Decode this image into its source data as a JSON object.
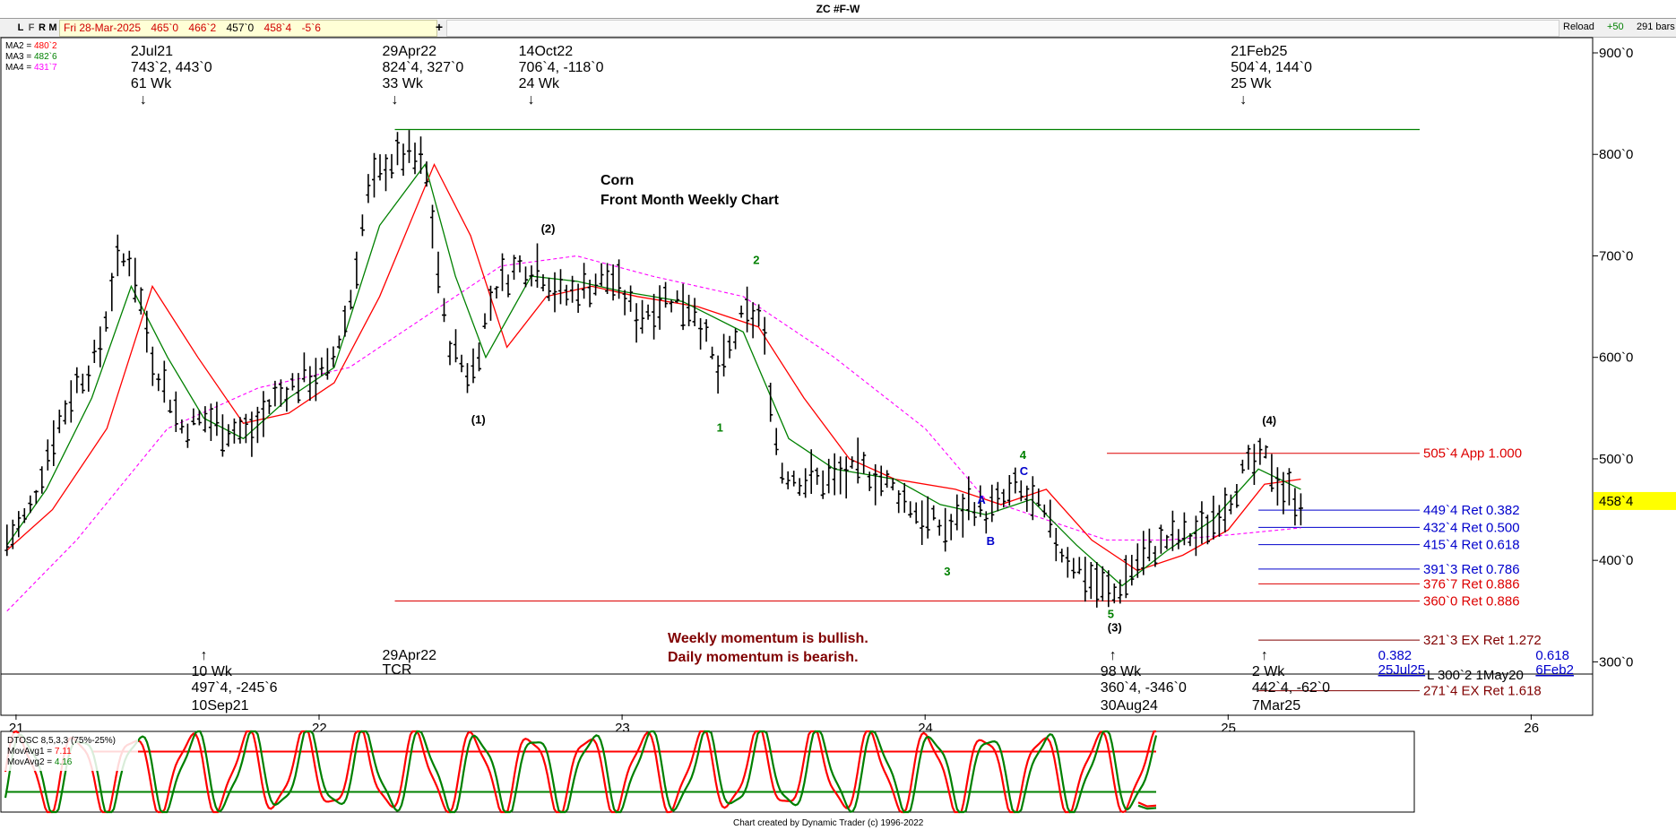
{
  "window": {
    "title": "ZC #F-W"
  },
  "toolbar": {
    "buttons": [
      "L",
      "F",
      "R",
      "M"
    ],
    "quote": [
      "Fri 28-Mar-2025",
      "465`0",
      "466`2",
      "457`0",
      "458`4",
      "-5`6"
    ],
    "reload_label": "Reload",
    "reload_value": "+50",
    "bars_label": "291 bars"
  },
  "colors": {
    "price_bars": "#000000",
    "ma2": "#ff0000",
    "ma3": "#008000",
    "ma4": "#ff00ff",
    "blue": "#0000cc",
    "red": "#dd0000",
    "dark_red": "#800000",
    "green": "#008000"
  },
  "legend": [
    {
      "label": "MA2 =",
      "value": "480`2",
      "color": "#ff0000"
    },
    {
      "label": "MA3 =",
      "value": "482`6",
      "color": "#008000"
    },
    {
      "label": "MA4 =",
      "value": "431`7",
      "color": "#ff00ff"
    }
  ],
  "chart_data": {
    "type": "line",
    "title": "Corn",
    "subtitle": "Front Month Weekly Chart",
    "x_ticks": [
      "21",
      "22",
      "23",
      "24",
      "25",
      "26"
    ],
    "y_ticks": [
      "900`0",
      "800`0",
      "700`0",
      "600`0",
      "500`0",
      "400`0",
      "300`0"
    ],
    "y_values": [
      900,
      800,
      700,
      600,
      500,
      400,
      300
    ],
    "ylim": [
      288,
      915
    ],
    "xlim": [
      2020.95,
      2026.2
    ],
    "last_price": "458`4",
    "last_price_value": 458.5,
    "price_path": [
      [
        2020.97,
        420
      ],
      [
        2021.04,
        445
      ],
      [
        2021.12,
        520
      ],
      [
        2021.2,
        575
      ],
      [
        2021.27,
        600
      ],
      [
        2021.33,
        690
      ],
      [
        2021.38,
        700
      ],
      [
        2021.45,
        600
      ],
      [
        2021.55,
        530
      ],
      [
        2021.62,
        540
      ],
      [
        2021.7,
        530
      ],
      [
        2021.78,
        525
      ],
      [
        2021.85,
        560
      ],
      [
        2021.95,
        580
      ],
      [
        2022.03,
        585
      ],
      [
        2022.1,
        650
      ],
      [
        2022.16,
        760
      ],
      [
        2022.22,
        790
      ],
      [
        2022.28,
        800
      ],
      [
        2022.35,
        790
      ],
      [
        2022.42,
        620
      ],
      [
        2022.5,
        580
      ],
      [
        2022.58,
        670
      ],
      [
        2022.66,
        690
      ],
      [
        2022.72,
        690
      ],
      [
        2022.8,
        660
      ],
      [
        2022.88,
        670
      ],
      [
        2022.96,
        680
      ],
      [
        2023.05,
        640
      ],
      [
        2023.15,
        660
      ],
      [
        2023.24,
        650
      ],
      [
        2023.32,
        580
      ],
      [
        2023.4,
        640
      ],
      [
        2023.46,
        640
      ],
      [
        2023.52,
        490
      ],
      [
        2023.6,
        480
      ],
      [
        2023.7,
        480
      ],
      [
        2023.8,
        490
      ],
      [
        2023.9,
        470
      ],
      [
        2024.0,
        440
      ],
      [
        2024.08,
        430
      ],
      [
        2024.15,
        460
      ],
      [
        2024.2,
        445
      ],
      [
        2024.3,
        470
      ],
      [
        2024.38,
        450
      ],
      [
        2024.45,
        410
      ],
      [
        2024.55,
        380
      ],
      [
        2024.62,
        365
      ],
      [
        2024.7,
        400
      ],
      [
        2024.8,
        420
      ],
      [
        2024.9,
        425
      ],
      [
        2025.0,
        460
      ],
      [
        2025.06,
        490
      ],
      [
        2025.13,
        500
      ],
      [
        2025.18,
        470
      ],
      [
        2025.24,
        458
      ]
    ],
    "ma_fast": [
      [
        2020.97,
        415
      ],
      [
        2021.1,
        470
      ],
      [
        2021.25,
        560
      ],
      [
        2021.38,
        670
      ],
      [
        2021.5,
        600
      ],
      [
        2021.62,
        540
      ],
      [
        2021.75,
        520
      ],
      [
        2021.9,
        560
      ],
      [
        2022.05,
        590
      ],
      [
        2022.2,
        730
      ],
      [
        2022.35,
        790
      ],
      [
        2022.45,
        680
      ],
      [
        2022.55,
        600
      ],
      [
        2022.7,
        680
      ],
      [
        2022.85,
        675
      ],
      [
        2023.0,
        665
      ],
      [
        2023.2,
        655
      ],
      [
        2023.4,
        625
      ],
      [
        2023.55,
        520
      ],
      [
        2023.7,
        490
      ],
      [
        2023.9,
        480
      ],
      [
        2024.05,
        455
      ],
      [
        2024.2,
        445
      ],
      [
        2024.35,
        460
      ],
      [
        2024.5,
        415
      ],
      [
        2024.65,
        375
      ],
      [
        2024.8,
        410
      ],
      [
        2024.95,
        440
      ],
      [
        2025.1,
        490
      ],
      [
        2025.24,
        470
      ]
    ],
    "ma_slow": [
      [
        2020.97,
        410
      ],
      [
        2021.12,
        450
      ],
      [
        2021.3,
        530
      ],
      [
        2021.45,
        670
      ],
      [
        2021.6,
        600
      ],
      [
        2021.75,
        535
      ],
      [
        2021.9,
        545
      ],
      [
        2022.05,
        575
      ],
      [
        2022.2,
        660
      ],
      [
        2022.38,
        790
      ],
      [
        2022.5,
        720
      ],
      [
        2022.62,
        610
      ],
      [
        2022.75,
        660
      ],
      [
        2022.9,
        670
      ],
      [
        2023.05,
        660
      ],
      [
        2023.25,
        650
      ],
      [
        2023.45,
        630
      ],
      [
        2023.6,
        560
      ],
      [
        2023.75,
        500
      ],
      [
        2023.9,
        480
      ],
      [
        2024.1,
        470
      ],
      [
        2024.25,
        455
      ],
      [
        2024.4,
        470
      ],
      [
        2024.55,
        420
      ],
      [
        2024.7,
        390
      ],
      [
        2024.85,
        405
      ],
      [
        2025.0,
        430
      ],
      [
        2025.12,
        475
      ],
      [
        2025.24,
        480
      ]
    ],
    "ma_long": [
      [
        2020.97,
        350
      ],
      [
        2021.2,
        420
      ],
      [
        2021.5,
        530
      ],
      [
        2021.8,
        570
      ],
      [
        2022.1,
        590
      ],
      [
        2022.35,
        640
      ],
      [
        2022.6,
        690
      ],
      [
        2022.85,
        700
      ],
      [
        2023.1,
        680
      ],
      [
        2023.4,
        660
      ],
      [
        2023.7,
        600
      ],
      [
        2024.0,
        530
      ],
      [
        2024.2,
        460
      ],
      [
        2024.4,
        440
      ],
      [
        2024.6,
        420
      ],
      [
        2024.8,
        420
      ],
      [
        2025.0,
        425
      ],
      [
        2025.24,
        432
      ]
    ],
    "series": [
      {
        "name": "MA2",
        "color": "#ff0000",
        "value": "480`2"
      },
      {
        "name": "MA3",
        "color": "#008000",
        "value": "482`6"
      },
      {
        "name": "MA4",
        "color": "#ff00ff",
        "value": "431`7"
      }
    ],
    "swing_labels_top": [
      {
        "x": 2021.42,
        "y": 900,
        "lines": [
          "2Jul21",
          "743`2, 443`0",
          "61 Wk",
          "↓"
        ]
      },
      {
        "x": 2022.25,
        "y": 900,
        "lines": [
          "29Apr22",
          "824`4, 327`0",
          "33 Wk",
          "↓"
        ]
      },
      {
        "x": 2022.7,
        "y": 900,
        "lines": [
          "14Oct22",
          "706`4, -118`0",
          "24 Wk",
          "↓"
        ]
      },
      {
        "x": 2025.05,
        "y": 900,
        "lines": [
          "21Feb25",
          "504`4, 144`0",
          "25 Wk",
          "↓"
        ]
      }
    ],
    "swing_labels_bottom": [
      {
        "x": 2021.62,
        "y": 330,
        "lines": [
          "↑",
          "10 Wk",
          "497`4, -245`6",
          "10Sep21"
        ]
      },
      {
        "x": 2022.25,
        "y": 330,
        "lines": [
          "29Apr22",
          "TCR"
        ]
      },
      {
        "x": 2024.62,
        "y": 330,
        "lines": [
          "↑",
          "98 Wk",
          "360`4, -346`0",
          "30Aug24"
        ]
      },
      {
        "x": 2025.12,
        "y": 330,
        "lines": [
          "↑",
          "2 Wk",
          "442`4, -62`0",
          "7Mar25"
        ]
      }
    ],
    "wave_labels": [
      {
        "text": "(1)",
        "x": 2022.52,
        "y": 535,
        "color": "#000000"
      },
      {
        "text": "(2)",
        "x": 2022.75,
        "y": 723,
        "color": "#000000"
      },
      {
        "text": "2",
        "x": 2023.45,
        "y": 692,
        "color": "#008000"
      },
      {
        "text": "1",
        "x": 2023.33,
        "y": 527,
        "color": "#008000"
      },
      {
        "text": "A",
        "x": 2024.19,
        "y": 456,
        "color": "#0000cc"
      },
      {
        "text": "B",
        "x": 2024.22,
        "y": 415,
        "color": "#0000cc"
      },
      {
        "text": "3",
        "x": 2024.08,
        "y": 385,
        "color": "#008000"
      },
      {
        "text": "4",
        "x": 2024.33,
        "y": 500,
        "color": "#008000"
      },
      {
        "text": "C",
        "x": 2024.33,
        "y": 484,
        "color": "#0000cc"
      },
      {
        "text": "5",
        "x": 2024.62,
        "y": 343,
        "color": "#008000"
      },
      {
        "text": "(3)",
        "x": 2024.62,
        "y": 330,
        "color": "#000000"
      },
      {
        "text": "(4)",
        "x": 2025.13,
        "y": 534,
        "color": "#000000"
      }
    ],
    "levels": [
      {
        "label": "505`4 App 1.000",
        "value": 505.5,
        "x_start": 2024.6,
        "color": "#dd0000"
      },
      {
        "label": "449`4 Ret 0.382",
        "value": 449.5,
        "x_start": 2025.1,
        "color": "#0000cc"
      },
      {
        "label": "432`4 Ret 0.500",
        "value": 432.5,
        "x_start": 2025.1,
        "color": "#0000cc"
      },
      {
        "label": "415`4 Ret 0.618",
        "value": 415.5,
        "x_start": 2025.1,
        "color": "#0000cc"
      },
      {
        "label": "391`3 Ret 0.786",
        "value": 391.4,
        "x_start": 2025.1,
        "color": "#0000cc"
      },
      {
        "label": "376`7 Ret 0.886",
        "value": 376.9,
        "x_start": 2025.1,
        "color": "#dd0000"
      },
      {
        "label": "360`0 Ret 0.886",
        "value": 360.0,
        "x_start": 2022.25,
        "color": "#dd0000"
      },
      {
        "label": "321`3 EX Ret 1.272",
        "value": 321.4,
        "x_start": 2025.1,
        "color": "#800000"
      },
      {
        "label": "271`4 EX Ret 1.618",
        "value": 271.5,
        "x_start": 2025.1,
        "color": "#800000"
      }
    ],
    "high_line": {
      "value": 824.5,
      "x_start": 2022.25,
      "color": "#008000"
    },
    "time_targets": [
      {
        "ratio": "0.382",
        "date": "25Jul25",
        "x": 2025.56
      },
      {
        "ratio": "0.618",
        "date": "6Feb2",
        "x": 2026.08
      }
    ],
    "lower_level_label": "L 300`2 1May20",
    "annotations": [
      "Weekly momentum is bullish.",
      "Daily momentum is bearish."
    ]
  },
  "oscillator": {
    "title": "DTOSC 8,5,3,3 (75%-25%)",
    "mavg1_label": "MovAvg1 =",
    "mavg1_value": "7.11",
    "mavg2_label": "MovAvg2 =",
    "mavg2_value": "4.16",
    "ob_level": 75,
    "os_level": 25,
    "ylim": [
      0,
      100
    ],
    "period_weeks": 11,
    "last_mavg1": 7.11,
    "last_mavg2": 4.16
  },
  "footer": {
    "credit": "Chart created by Dynamic Trader  (c) 1996-2022"
  }
}
